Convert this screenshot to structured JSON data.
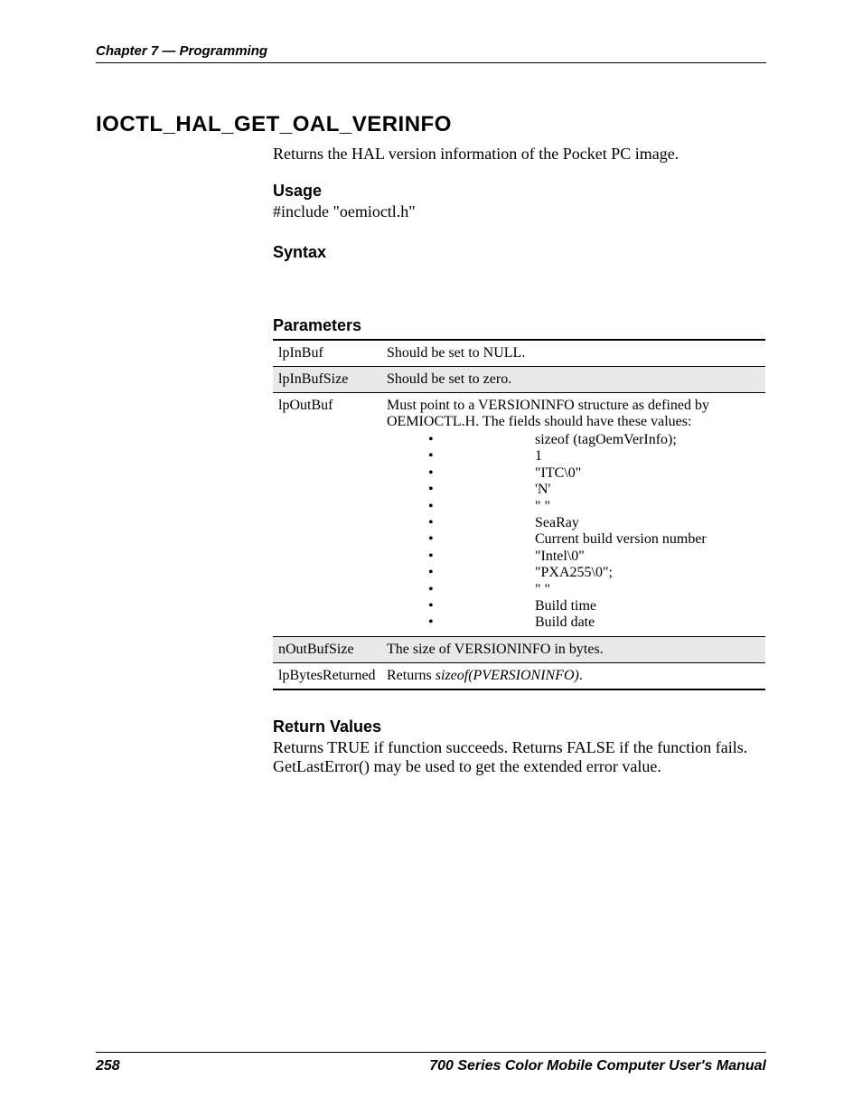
{
  "header": {
    "chapter_line": "Chapter 7 — Programming"
  },
  "title": "IOCTL_HAL_GET_OAL_VERINFO",
  "intro": "Returns the HAL version information of the Pocket PC image.",
  "sections": {
    "usage_heading": "Usage",
    "usage_text": "#include \"oemioctl.h\"",
    "syntax_heading": "Syntax",
    "parameters_heading": "Parameters",
    "return_heading": "Return Values",
    "return_text": "Returns TRUE if function succeeds. Returns FALSE if the function fails. GetLastError() may be used to get the extended error value."
  },
  "params": {
    "rows": [
      {
        "name": "lpInBuf",
        "desc": "Should be set to NULL."
      },
      {
        "name": "lpInBufSize",
        "desc": "Should be set to zero."
      },
      {
        "name": "lpOutBuf",
        "desc_lead": "Must point to a VERSIONINFO structure as defined by OEMIOCTL.H. The fields should have these values:",
        "bullets": [
          "sizeof (tagOemVerInfo);",
          "1",
          "\"ITC\\0\"",
          "'N'",
          "\" \"",
          "SeaRay",
          "Current build version number",
          "\"Intel\\0\"",
          "\"PXA255\\0\";",
          "\" \"",
          "Build time",
          "Build date"
        ]
      },
      {
        "name": "nOutBufSize",
        "desc": "The size of VERSIONINFO in bytes."
      },
      {
        "name": "lpBytesReturned",
        "desc_prefix": "Returns ",
        "desc_italic": "sizeof(PVERSIONINFO)",
        "desc_suffix": "."
      }
    ]
  },
  "footer": {
    "page_number": "258",
    "manual_title": "700 Series Color Mobile Computer User's Manual"
  }
}
